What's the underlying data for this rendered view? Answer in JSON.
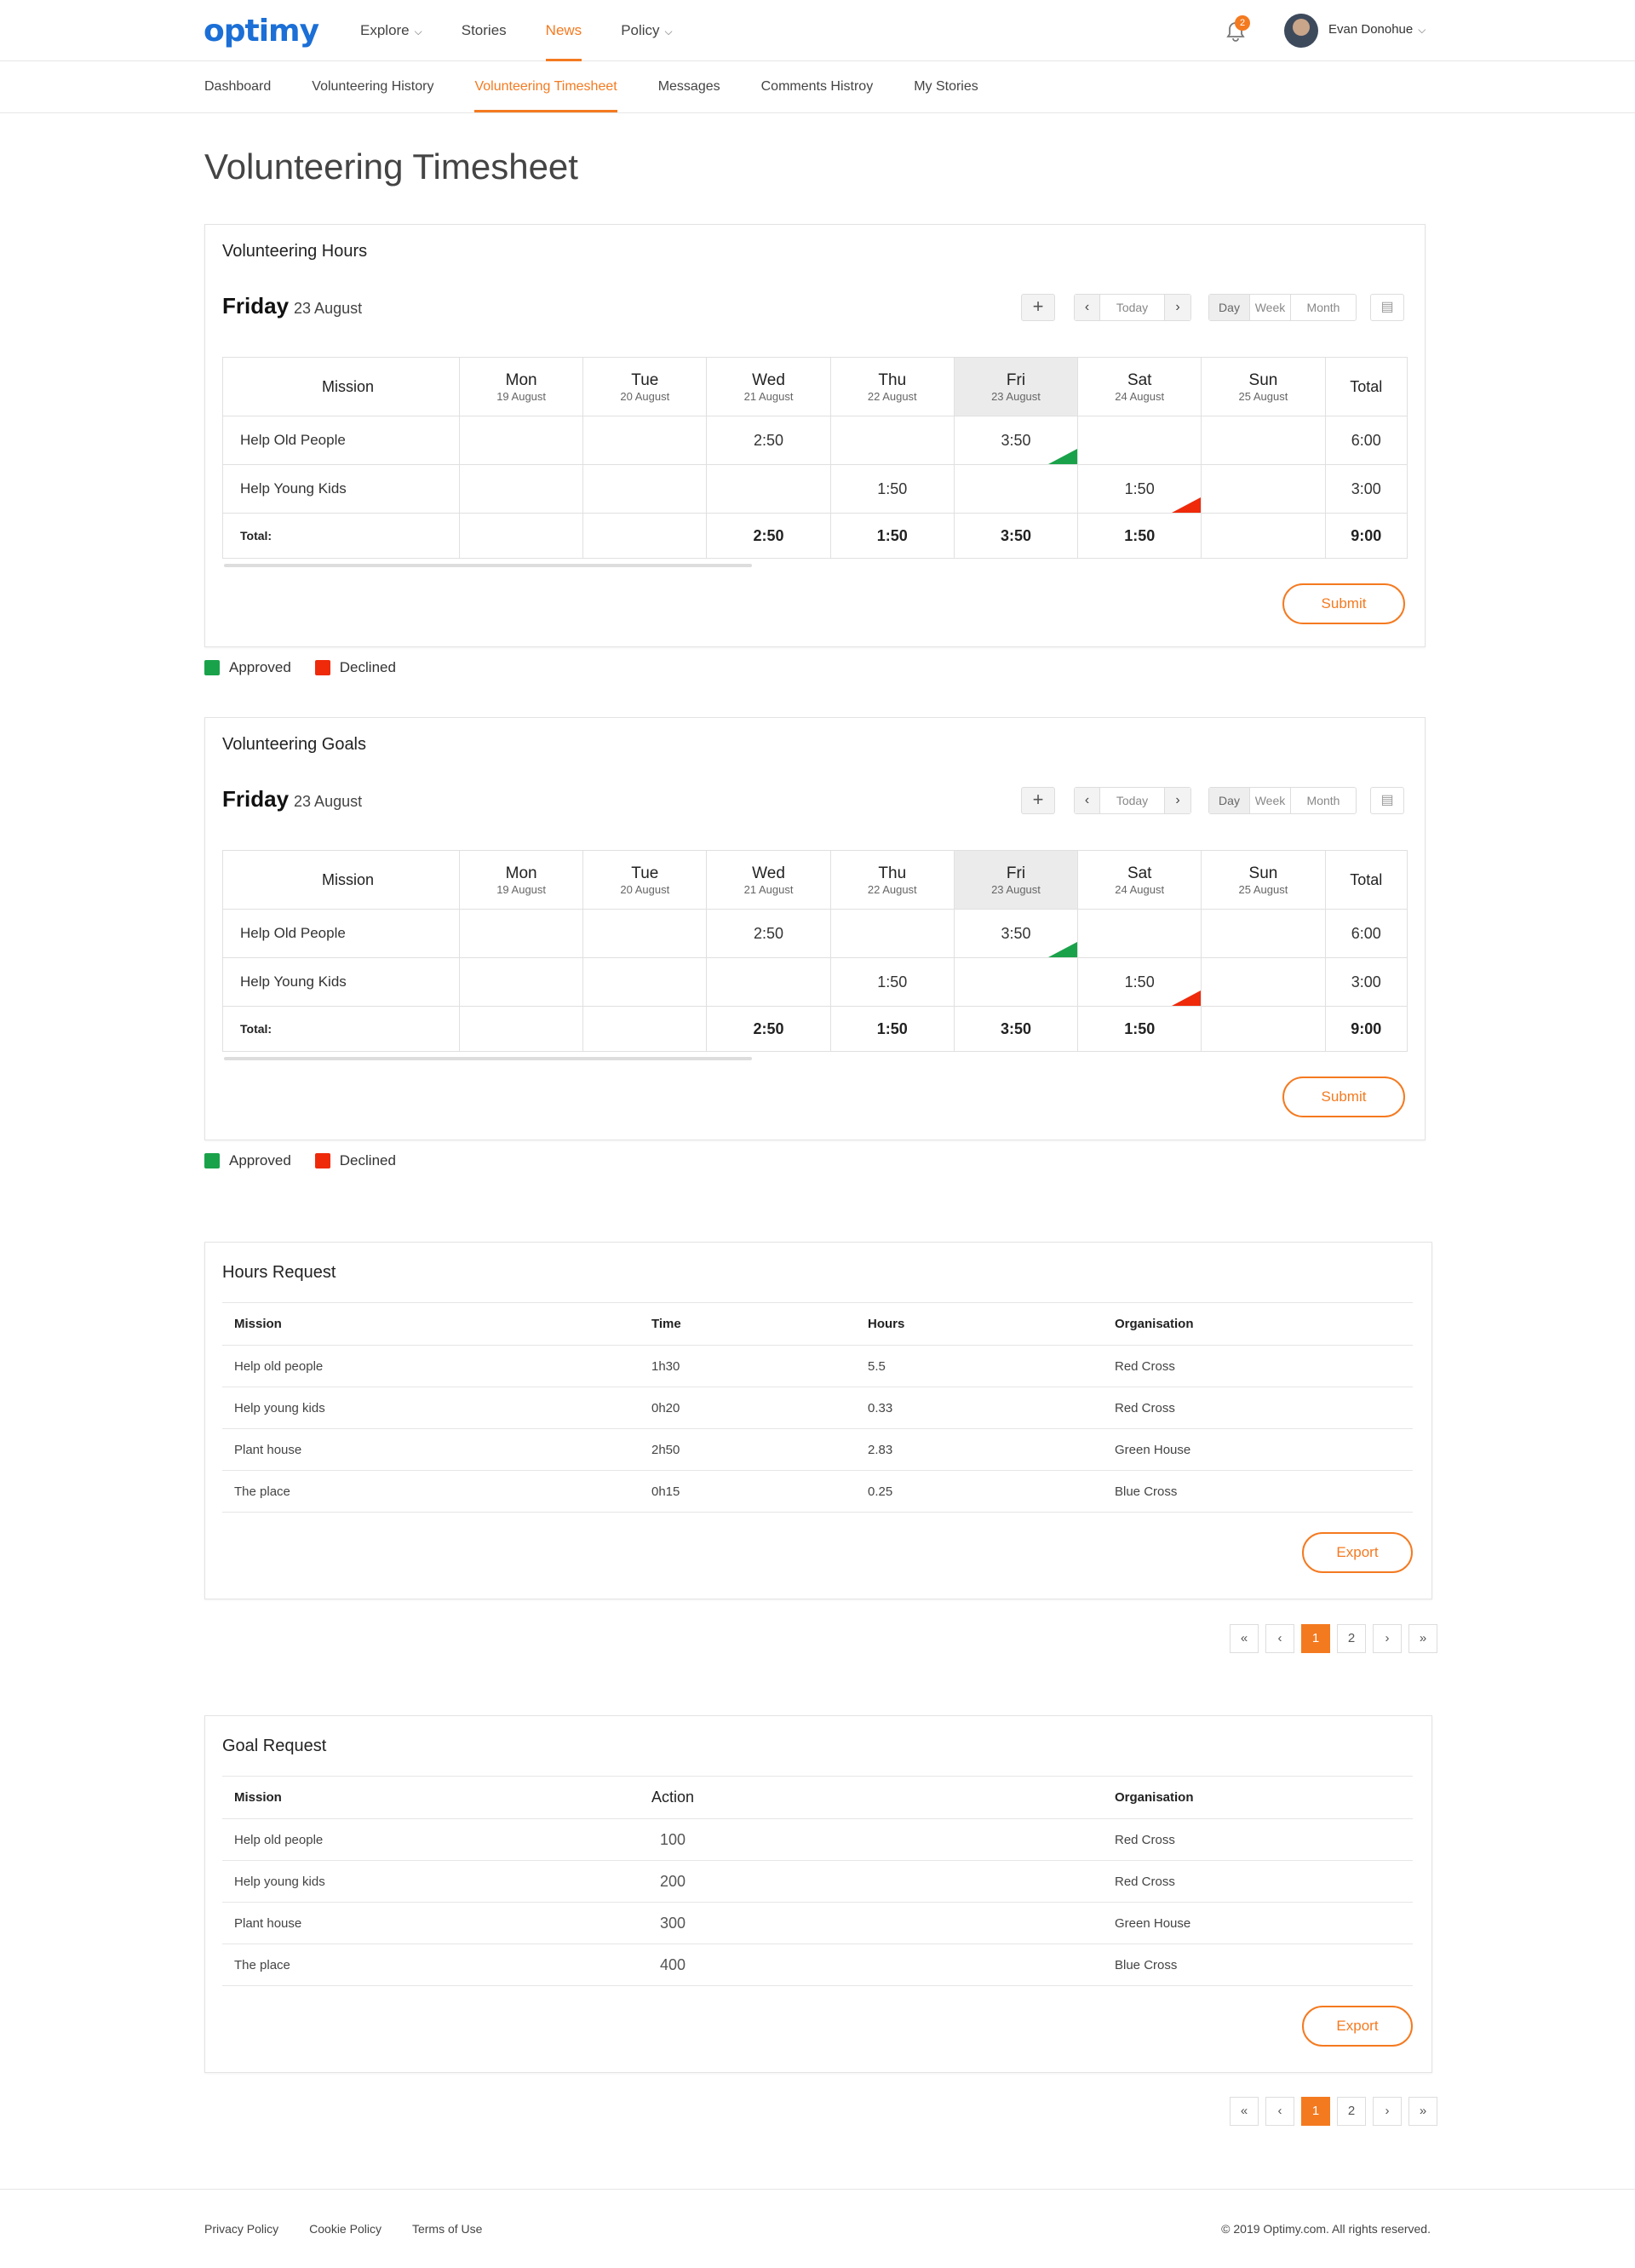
{
  "header": {
    "logo": "optimy",
    "nav": [
      {
        "label": "Explore",
        "dropdown": true,
        "active": false
      },
      {
        "label": "Stories",
        "dropdown": false,
        "active": false
      },
      {
        "label": "News",
        "dropdown": false,
        "active": true
      },
      {
        "label": "Policy",
        "dropdown": true,
        "active": false
      }
    ],
    "notifications_count": "2",
    "user_name": "Evan Donohue"
  },
  "subnav": [
    {
      "label": "Dashboard",
      "active": false
    },
    {
      "label": "Volunteering History",
      "active": false
    },
    {
      "label": "Volunteering Timesheet",
      "active": true
    },
    {
      "label": "Messages",
      "active": false
    },
    {
      "label": "Comments Histroy",
      "active": false
    },
    {
      "label": "My Stories",
      "active": false
    }
  ],
  "page_title": "Volunteering Timesheet",
  "timesheets": [
    {
      "title": "Volunteering Hours",
      "day_name": "Friday",
      "day_date": "23 August",
      "controls": {
        "add": "+",
        "prev": "‹",
        "today": "Today",
        "next": "›",
        "views": [
          "Day",
          "Week",
          "Month"
        ],
        "active_view": "Day"
      },
      "columns": {
        "mission": "Mission",
        "days": [
          {
            "name": "Mon",
            "date": "19 August"
          },
          {
            "name": "Tue",
            "date": "20 August"
          },
          {
            "name": "Wed",
            "date": "21 August"
          },
          {
            "name": "Thu",
            "date": "22 August"
          },
          {
            "name": "Fri",
            "date": "23 August"
          },
          {
            "name": "Sat",
            "date": "24 August"
          },
          {
            "name": "Sun",
            "date": "25 August"
          }
        ],
        "total": "Total"
      },
      "rows": [
        {
          "mission": "Help Old People",
          "cells": [
            "",
            "",
            "2:50",
            "",
            "3:50",
            "",
            ""
          ],
          "total": "6:00"
        },
        {
          "mission": "Help Young Kids",
          "cells": [
            "",
            "",
            "",
            "1:50",
            "",
            "1:50",
            ""
          ],
          "total": "3:00"
        }
      ],
      "totals": {
        "label": "Total:",
        "cells": [
          "",
          "",
          "2:50",
          "1:50",
          "3:50",
          "1:50",
          ""
        ],
        "total": "9:00"
      },
      "submit_label": "Submit"
    },
    {
      "title": "Volunteering Goals",
      "day_name": "Friday",
      "day_date": "23 August",
      "controls": {
        "add": "+",
        "prev": "‹",
        "today": "Today",
        "next": "›",
        "views": [
          "Day",
          "Week",
          "Month"
        ],
        "active_view": "Day"
      },
      "columns": {
        "mission": "Mission",
        "days": [
          {
            "name": "Mon",
            "date": "19 August"
          },
          {
            "name": "Tue",
            "date": "20 August"
          },
          {
            "name": "Wed",
            "date": "21 August"
          },
          {
            "name": "Thu",
            "date": "22 August"
          },
          {
            "name": "Fri",
            "date": "23 August"
          },
          {
            "name": "Sat",
            "date": "24 August"
          },
          {
            "name": "Sun",
            "date": "25 August"
          }
        ],
        "total": "Total"
      },
      "rows": [
        {
          "mission": "Help Old People",
          "cells": [
            "",
            "",
            "2:50",
            "",
            "3:50",
            "",
            ""
          ],
          "total": "6:00"
        },
        {
          "mission": "Help Young Kids",
          "cells": [
            "",
            "",
            "",
            "1:50",
            "",
            "1:50",
            ""
          ],
          "total": "3:00"
        }
      ],
      "totals": {
        "label": "Total:",
        "cells": [
          "",
          "",
          "2:50",
          "1:50",
          "3:50",
          "1:50",
          ""
        ],
        "total": "9:00"
      },
      "submit_label": "Submit"
    }
  ],
  "legend": {
    "approved": "Approved",
    "declined": "Declined",
    "approved_color": "#1aa24a",
    "declined_color": "#ee2a0b"
  },
  "hours_request": {
    "title": "Hours Request",
    "headers": [
      "Mission",
      "Time",
      "Hours",
      "Organisation"
    ],
    "rows": [
      [
        "Help old people",
        "1h30",
        "5.5",
        "Red Cross"
      ],
      [
        "Help young kids",
        "0h20",
        "0.33",
        "Red Cross"
      ],
      [
        "Plant house",
        "2h50",
        "2.83",
        "Green House"
      ],
      [
        "The place",
        "0h15",
        "0.25",
        "Blue Cross"
      ]
    ],
    "export_label": "Export"
  },
  "goal_request": {
    "title": "Goal Request",
    "headers": [
      "Mission",
      "Action",
      "Organisation"
    ],
    "rows": [
      [
        "Help old people",
        "100",
        "Red Cross"
      ],
      [
        "Help young kids",
        "200",
        "Red Cross"
      ],
      [
        "Plant house",
        "300",
        "Green House"
      ],
      [
        "The place",
        "400",
        "Blue Cross"
      ]
    ],
    "export_label": "Export"
  },
  "pagination": [
    "«",
    "‹",
    "1",
    "2",
    "›",
    "»"
  ],
  "pagination_current": "1",
  "footer": {
    "links": [
      "Privacy Policy",
      "Cookie Policy",
      "Terms of Use"
    ],
    "copyright": "© 2019 Optimy.com. All rights reserved."
  },
  "colors": {
    "accent": "#f47a20",
    "logo": "#1b6fd6"
  }
}
